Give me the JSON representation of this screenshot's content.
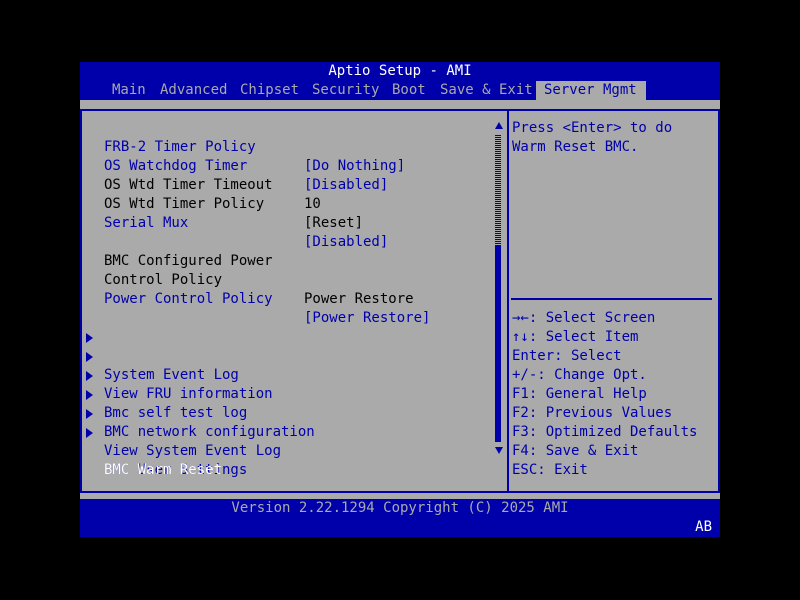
{
  "app_title": "Aptio Setup - AMI",
  "tabs": [
    {
      "label": "Main"
    },
    {
      "label": "Advanced"
    },
    {
      "label": "Chipset"
    },
    {
      "label": "Security"
    },
    {
      "label": "Boot"
    },
    {
      "label": "Save & Exit"
    },
    {
      "label": "Server Mgmt"
    }
  ],
  "active_tab": "Server Mgmt",
  "settings": [
    {
      "label": "FRB-2 Timer Policy",
      "value": "[Do Nothing]",
      "selectable": true
    },
    {
      "label": "OS Watchdog Timer",
      "value": "[Disabled]",
      "selectable": true
    },
    {
      "label": "OS Wtd Timer Timeout",
      "value": "10",
      "selectable": false
    },
    {
      "label": "OS Wtd Timer Policy",
      "value": "[Reset]",
      "selectable": false
    },
    {
      "label": "Serial Mux",
      "value": "[Disabled]",
      "selectable": true
    },
    {
      "label": "BMC Configured Power",
      "value": "",
      "selectable": false
    },
    {
      "label": "Control Policy",
      "value": "Power Restore",
      "selectable": false
    },
    {
      "label": "Power Control Policy",
      "value": "[Power Restore]",
      "selectable": true
    }
  ],
  "submenus": [
    {
      "label": "System Event Log"
    },
    {
      "label": "View FRU information"
    },
    {
      "label": "Bmc self test log"
    },
    {
      "label": "BMC network configuration"
    },
    {
      "label": "View System Event Log"
    },
    {
      "label": "BMC User Settings"
    }
  ],
  "selected_item": {
    "label": "BMC Warm Reset"
  },
  "scrollbar": {
    "position_fraction": 0.36,
    "visible_fraction": 0.64
  },
  "help": {
    "description": [
      "Press <Enter> to do",
      "Warm Reset BMC."
    ],
    "keys": [
      "→←: Select Screen",
      "↑↓: Select Item",
      "Enter: Select",
      "+/-: Change Opt.",
      "F1: General Help",
      "F2: Previous Values",
      "F3: Optimized Defaults",
      "F4: Save & Exit",
      "ESC: Exit"
    ]
  },
  "footer": {
    "version": "Version 2.22.1294 Copyright (C) 2025 AMI",
    "post_code": "AB"
  },
  "colors": {
    "background": "#aaaaaa",
    "bar": "#0000aa",
    "highlight_text": "#ffffff",
    "screen_border": "#000000"
  }
}
